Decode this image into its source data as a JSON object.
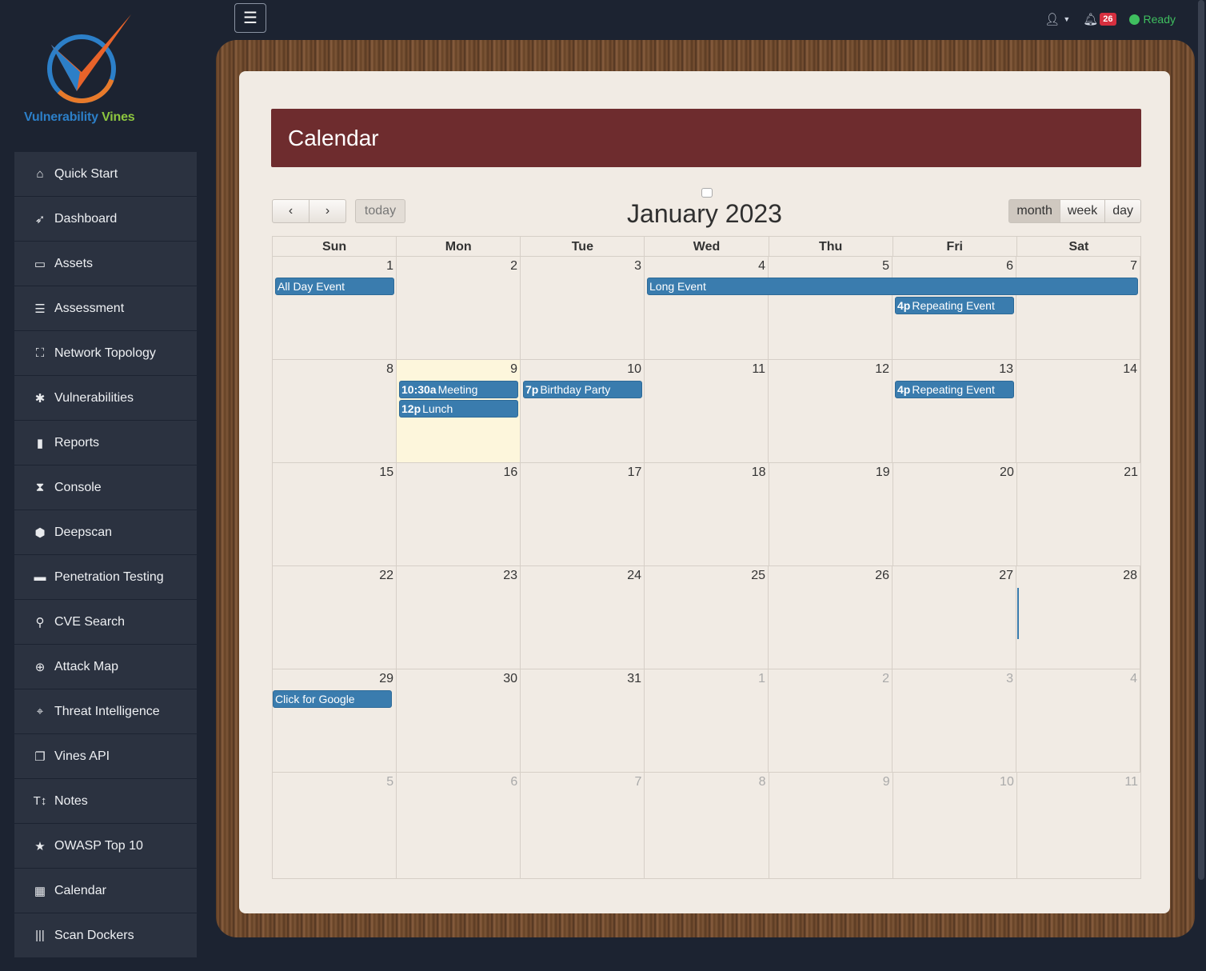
{
  "brand": {
    "word1": "Vulnerability",
    "word2": "Vines"
  },
  "nav": [
    {
      "label": "Quick Start",
      "icon": "home-icon",
      "glyph": "⌂"
    },
    {
      "label": "Dashboard",
      "icon": "rocket-icon",
      "glyph": "➶"
    },
    {
      "label": "Assets",
      "icon": "laptop-icon",
      "glyph": "▭"
    },
    {
      "label": "Assessment",
      "icon": "list-icon",
      "glyph": "☰"
    },
    {
      "label": "Network Topology",
      "icon": "sitemap-icon",
      "glyph": "⛶"
    },
    {
      "label": "Vulnerabilities",
      "icon": "bug-icon",
      "glyph": "✱"
    },
    {
      "label": "Reports",
      "icon": "file-icon",
      "glyph": "▮"
    },
    {
      "label": "Console",
      "icon": "hourglass-icon",
      "glyph": "⧗"
    },
    {
      "label": "Deepscan",
      "icon": "cube-icon",
      "glyph": "⬢"
    },
    {
      "label": "Penetration Testing",
      "icon": "hdd-icon",
      "glyph": "▬"
    },
    {
      "label": "CVE Search",
      "icon": "search-icon",
      "glyph": "⚲"
    },
    {
      "label": "Attack Map",
      "icon": "globe-icon",
      "glyph": "⊕"
    },
    {
      "label": "Threat Intelligence",
      "icon": "crosshairs-icon",
      "glyph": "⌖"
    },
    {
      "label": "Vines API",
      "icon": "window-icon",
      "glyph": "❐"
    },
    {
      "label": "Notes",
      "icon": "text-height-icon",
      "glyph": "T↕"
    },
    {
      "label": "OWASP Top 10",
      "icon": "star-icon",
      "glyph": "★"
    },
    {
      "label": "Calendar",
      "icon": "calendar-icon",
      "glyph": "▦"
    },
    {
      "label": "Scan Dockers",
      "icon": "barcode-icon",
      "glyph": "|||"
    }
  ],
  "topbar": {
    "notifications": "26",
    "status": "Ready"
  },
  "calendar": {
    "header": "Calendar",
    "title": "January 2023",
    "today_label": "today",
    "views": [
      "month",
      "week",
      "day"
    ],
    "days_of_week": [
      "Sun",
      "Mon",
      "Tue",
      "Wed",
      "Thu",
      "Fri",
      "Sat"
    ],
    "weeks": [
      [
        "1",
        "2",
        "3",
        "4",
        "5",
        "6",
        "7"
      ],
      [
        "8",
        "9",
        "10",
        "11",
        "12",
        "13",
        "14"
      ],
      [
        "15",
        "16",
        "17",
        "18",
        "19",
        "20",
        "21"
      ],
      [
        "22",
        "23",
        "24",
        "25",
        "26",
        "27",
        "28"
      ],
      [
        "29",
        "30",
        "31",
        "1",
        "2",
        "3",
        "4"
      ],
      [
        "5",
        "6",
        "7",
        "8",
        "9",
        "10",
        "11"
      ]
    ],
    "events": {
      "all_day": "All Day Event",
      "long": "Long Event",
      "repeat1_time": "4p",
      "repeat1_title": "Repeating Event",
      "meeting_time": "10:30a",
      "meeting_title": "Meeting",
      "lunch_time": "12p",
      "lunch_title": "Lunch",
      "birthday_time": "7p",
      "birthday_title": "Birthday Party",
      "repeat2_time": "4p",
      "repeat2_title": "Repeating Event",
      "google": "Click for Google"
    }
  }
}
